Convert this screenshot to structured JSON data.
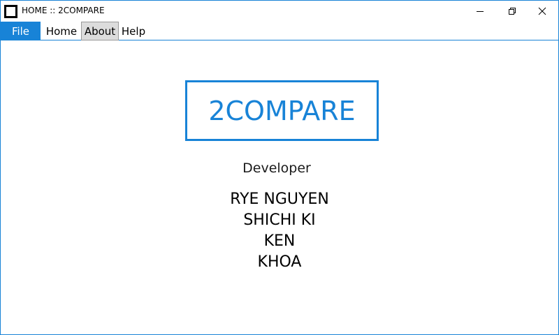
{
  "window": {
    "title": "HOME :: 2COMPARE",
    "accent_color": "#1883d7",
    "controls": {
      "minimize_icon": "minimize-icon",
      "maximize_icon": "restore-icon",
      "close_icon": "close-icon"
    }
  },
  "menu": {
    "items": [
      {
        "label": "File",
        "state": "highlighted"
      },
      {
        "label": "Home",
        "state": "normal"
      },
      {
        "label": "About",
        "state": "selected"
      },
      {
        "label": "Help",
        "state": "normal"
      }
    ]
  },
  "content": {
    "logo_text": "2COMPARE",
    "developer_heading": "Developer",
    "developers": [
      "RYE NGUYEN",
      "SHICHI KI",
      "KEN",
      "KHOA"
    ]
  }
}
